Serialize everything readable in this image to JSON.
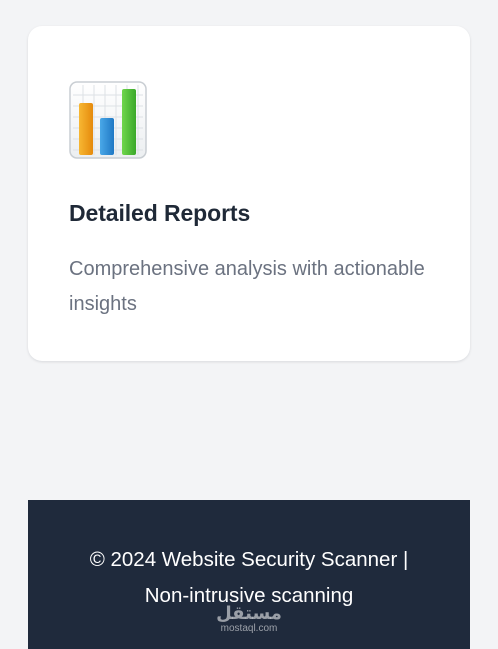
{
  "feature_card": {
    "icon": "bar-chart-icon",
    "title": "Detailed Reports",
    "description": "Comprehensive analysis with actionable insights"
  },
  "footer": {
    "text_line1": "© 2024 Website Security Scanner |",
    "text_line2": "Non-intrusive scanning",
    "background": "#1f2a3c"
  },
  "watermark": {
    "arabic": "مستقل",
    "latin": "mostaql.com"
  },
  "colors": {
    "page_bg": "#f3f4f6",
    "card_bg": "#ffffff",
    "title": "#1f2937",
    "description": "#6b7280",
    "bar_orange": "#f4a21a",
    "bar_blue": "#2e8fd6",
    "bar_green": "#55c33a"
  }
}
